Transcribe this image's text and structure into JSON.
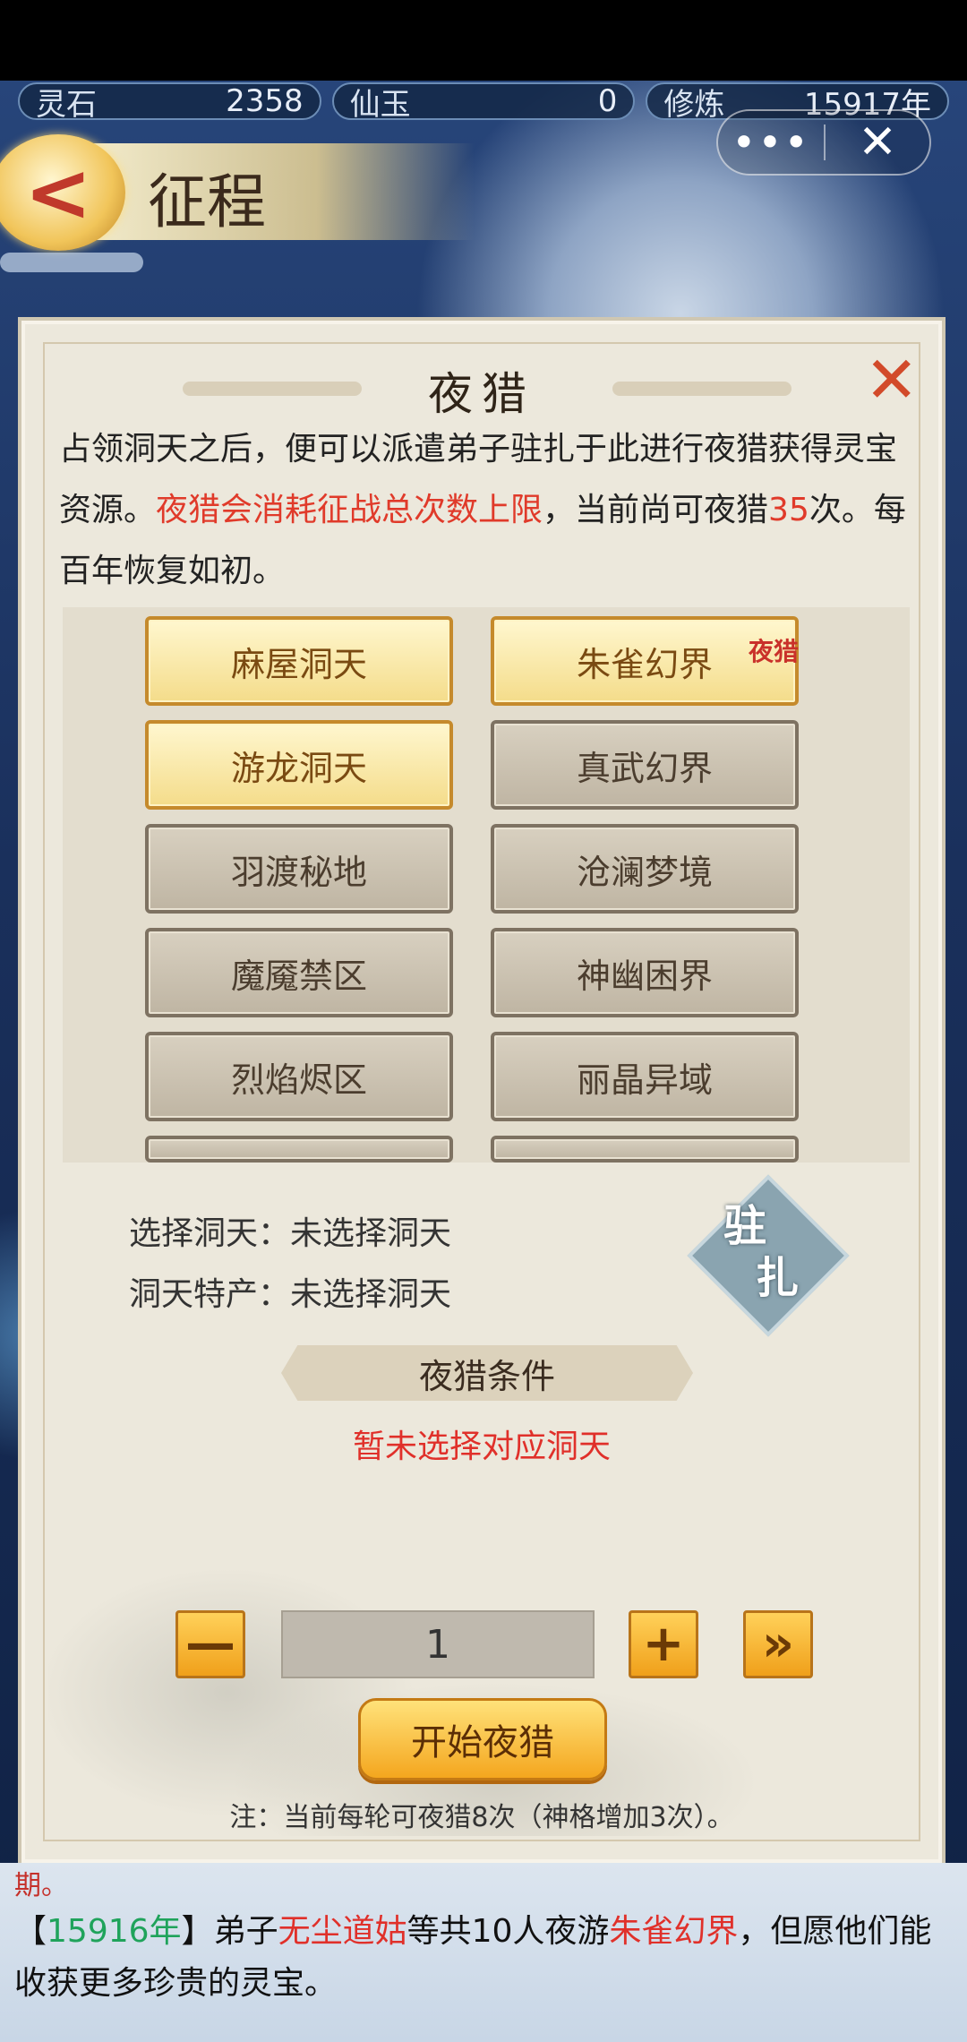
{
  "resources": [
    {
      "label": "灵石",
      "value": "2358"
    },
    {
      "label": "仙玉",
      "value": "0"
    },
    {
      "label": "修炼",
      "value": "15917年"
    }
  ],
  "capsule": {
    "more": "•••",
    "close": "✕"
  },
  "header": {
    "back": "<",
    "title": "征程"
  },
  "dialog": {
    "title": "夜猎",
    "close": "✕",
    "desc": {
      "part1": "占领洞天之后，便可以派遣弟子驻扎于此进行夜猎获得灵宝资源。",
      "red1": "夜猎会消耗征战总次数上限",
      "part2": "，当前尚可夜猎",
      "red2": "35",
      "part3": "次。每百年恢复如初。"
    },
    "destinations": [
      {
        "label": "麻屋洞天",
        "selected": true
      },
      {
        "label": "朱雀幻界",
        "selected": true,
        "badge": "夜猎"
      },
      {
        "label": "游龙洞天",
        "selected": true
      },
      {
        "label": "真武幻界",
        "selected": false
      },
      {
        "label": "羽渡秘地",
        "selected": false
      },
      {
        "label": "沧澜梦境",
        "selected": false
      },
      {
        "label": "魔魇禁区",
        "selected": false
      },
      {
        "label": "神幽困界",
        "selected": false
      },
      {
        "label": "烈焰烬区",
        "selected": false
      },
      {
        "label": "丽晶异域",
        "selected": false
      }
    ],
    "select_line": "选择洞天：未选择洞天",
    "product_line": "洞天特产：未选择洞天",
    "station": {
      "line1": "驻",
      "line2": "扎"
    },
    "conditions_title": "夜猎条件",
    "conditions_msg": "暂未选择对应洞天",
    "quantity": {
      "minus": "—",
      "value": "1",
      "plus": "+",
      "max": "»"
    },
    "start_button": "开始夜猎",
    "note": "注：当前每轮可夜猎8次（神格增加3次）。"
  },
  "log": {
    "partial": "期。",
    "open": "【",
    "year": "15916年",
    "close": "】",
    "t1": "弟子",
    "person": "无尘道姑",
    "t2": "等共10人夜游",
    "place": "朱雀幻界",
    "t3": "，但愿他们能收获更多珍贵的灵宝。"
  }
}
